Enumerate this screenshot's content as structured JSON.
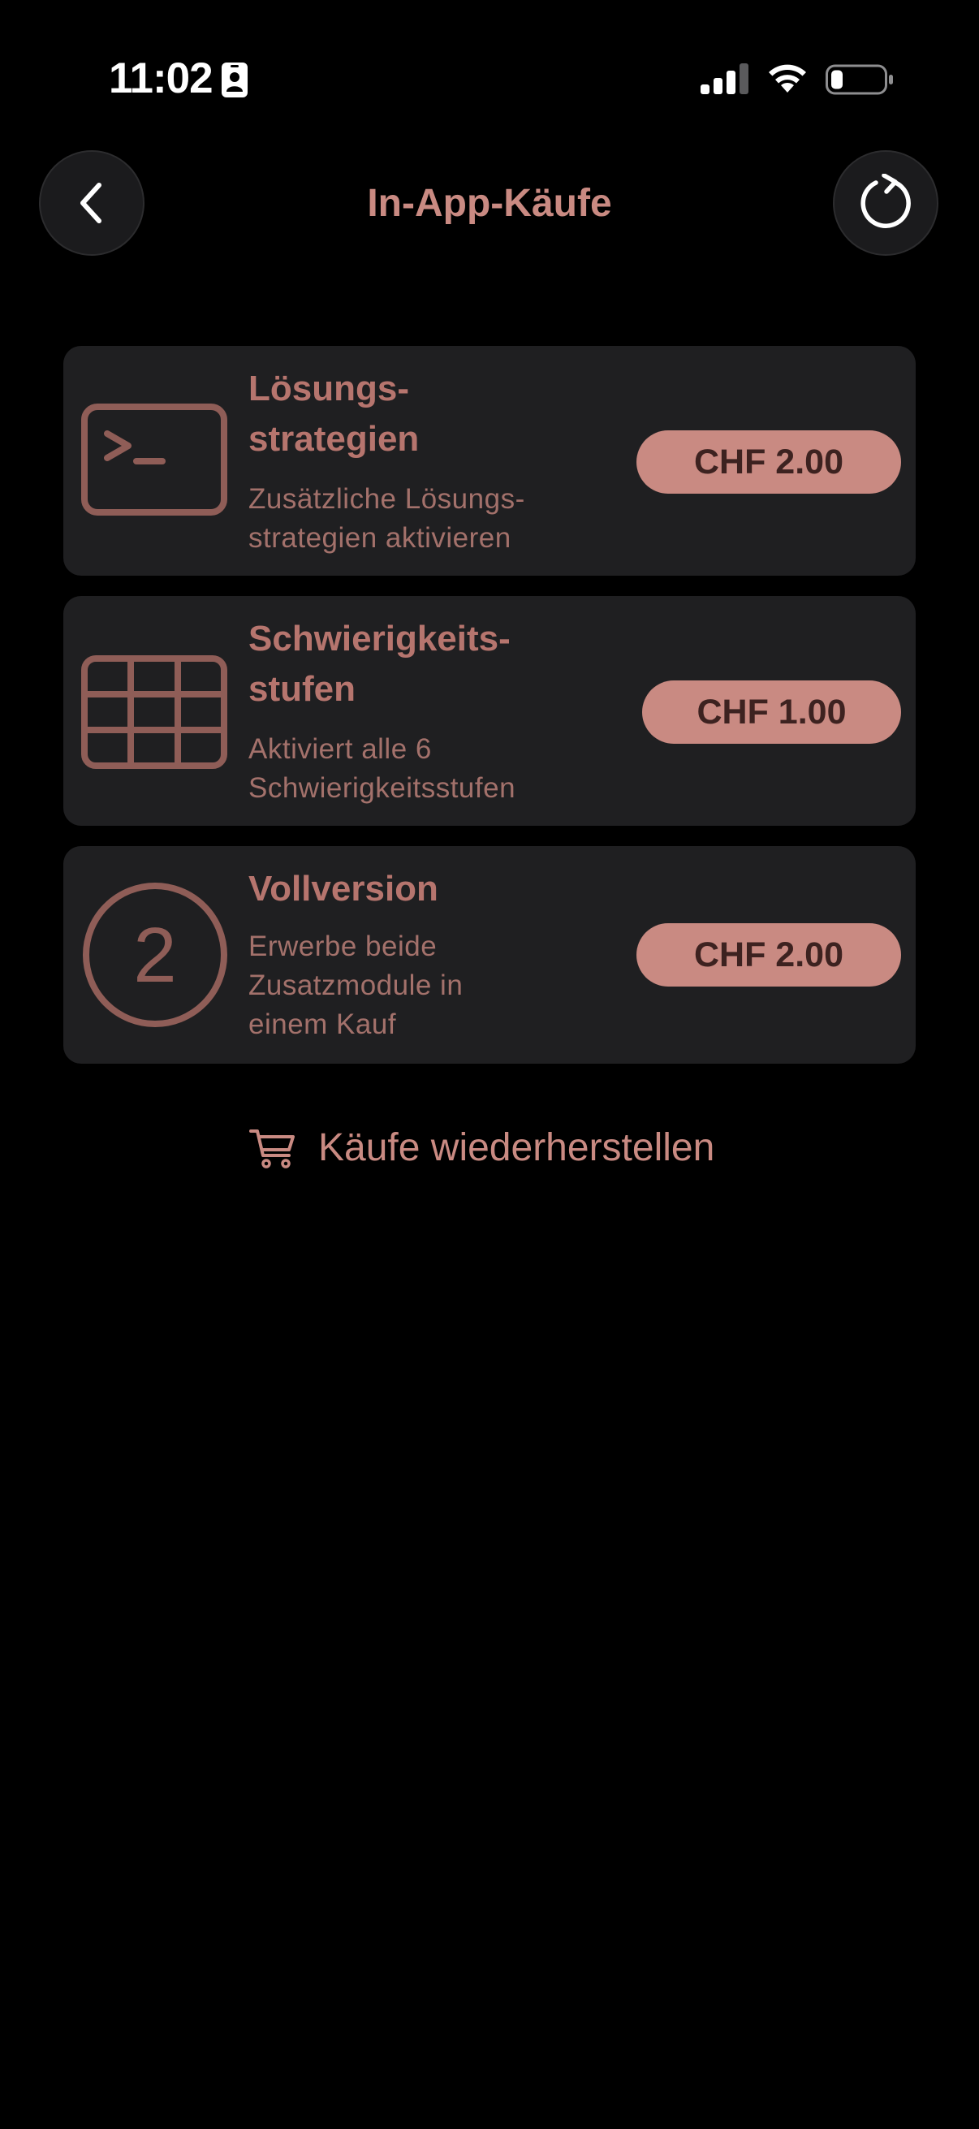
{
  "status_bar": {
    "time": "11:02",
    "icons": [
      "id-card-icon",
      "cellular-signal-icon",
      "wifi-icon",
      "battery-icon"
    ]
  },
  "nav": {
    "title": "In-App-Käufe",
    "back_icon": "chevron-left-icon",
    "refresh_icon": "refresh-icon"
  },
  "products": [
    {
      "icon": "terminal-icon",
      "title_line1": "Lösungs-",
      "title_line2": "strategien",
      "desc_line1": "Zusätzliche Lösungs-",
      "desc_line2": "strategien aktivieren",
      "price": "CHF 2.00"
    },
    {
      "icon": "grid-icon",
      "title_line1": "Schwierigkeits-",
      "title_line2": "stufen",
      "desc_line1": "Aktiviert alle 6",
      "desc_line2": "Schwierigkeitsstufen",
      "price": "CHF 1.00"
    },
    {
      "icon": "number-2-circle-icon",
      "icon_text": "2",
      "title_line1": "Vollversion",
      "desc_line1": "Erwerbe beide",
      "desc_line2": "Zusatzmodule in",
      "desc_line3": "einem Kauf",
      "price": "CHF 2.00"
    }
  ],
  "restore": {
    "icon": "cart-icon",
    "label": "Käufe wiederherstellen"
  },
  "colors": {
    "background": "#000000",
    "card": "#1f1f21",
    "accent": "#c98a82",
    "title_text": "#b6756e",
    "desc_text": "#a3716b",
    "icon": "#8f5d57",
    "price_text": "#3d2220"
  }
}
